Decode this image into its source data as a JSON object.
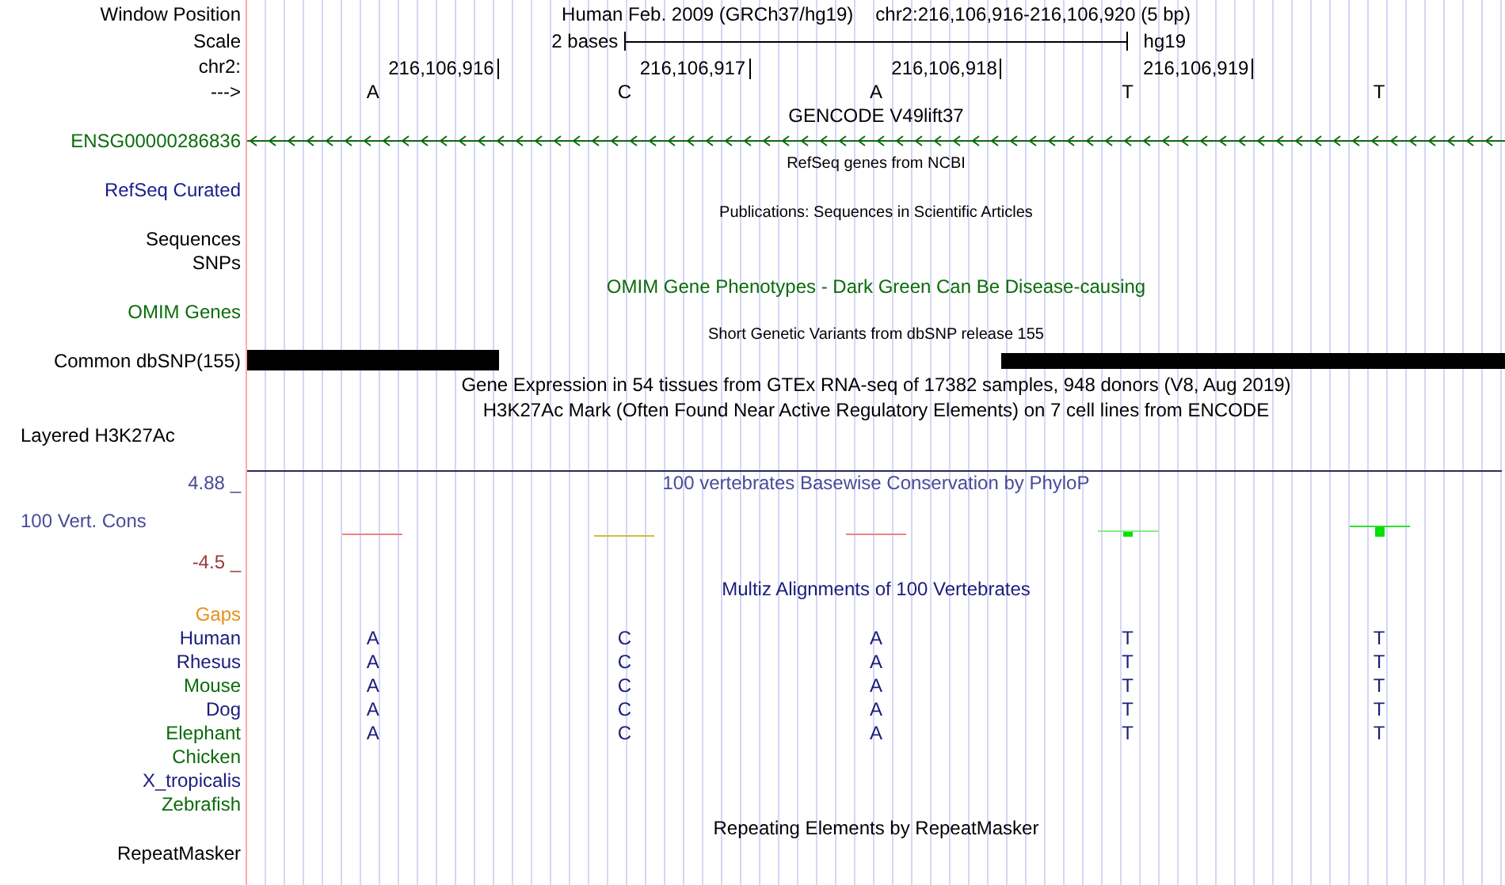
{
  "rows": [
    {
      "kind": "title",
      "label": "Window Position",
      "assembly": "Human Feb. 2009 (GRCh37/hg19)",
      "position": "chr2:216,106,916-216,106,920 (5 bp)"
    },
    {
      "kind": "scale",
      "label": "Scale",
      "scale_text": "2 bases",
      "scale_assembly": "hg19"
    },
    {
      "kind": "ruler",
      "label": "chr2:",
      "ticks": [
        "216,106,916",
        "216,106,917",
        "216,106,918",
        "216,106,919"
      ]
    },
    {
      "kind": "bases",
      "label": "--->",
      "bases": [
        "A",
        "C",
        "A",
        "T",
        "T"
      ]
    },
    {
      "kind": "caption",
      "text": "GENCODE V49lift37",
      "color": "#000000"
    },
    {
      "kind": "gene",
      "label": "ENSG00000286836",
      "color": "#0b6b0b"
    },
    {
      "kind": "note",
      "text": "RefSeq genes from NCBI"
    },
    {
      "kind": "track",
      "label": "RefSeq Curated",
      "color": "#1c1c8c"
    },
    {
      "kind": "note",
      "text": "Publications: Sequences in Scientific Articles"
    },
    {
      "kind": "track",
      "label": "Sequences",
      "color": "#000000"
    },
    {
      "kind": "track",
      "label": "SNPs",
      "color": "#000000"
    },
    {
      "kind": "caption",
      "text": "OMIM Gene Phenotypes - Dark Green Can Be Disease-causing",
      "color": "#0b6b0b"
    },
    {
      "kind": "track",
      "label": "OMIM Genes",
      "color": "#0b6b0b"
    },
    {
      "kind": "note",
      "text": "Short Genetic Variants from dbSNP release 155"
    },
    {
      "kind": "snp_bars",
      "label": "Common dbSNP(155)",
      "color": "#000000"
    },
    {
      "kind": "caption",
      "text": "Gene Expression in 54 tissues from GTEx RNA-seq of 17382 samples, 948 donors (V8, Aug 2019)",
      "color": "#000000"
    },
    {
      "kind": "caption",
      "text": "H3K27Ac Mark (Often Found Near Active Regulatory Elements) on 7 cell lines from ENCODE",
      "color": "#000000"
    },
    {
      "kind": "left_label",
      "label": "Layered H3K27Ac",
      "color": "#000000"
    },
    {
      "kind": "rule"
    },
    {
      "kind": "axis_top",
      "label": "4.88 _",
      "text": "100 vertebrates Basewise Conservation by PhyloP",
      "color": "#4a4a9a"
    },
    {
      "kind": "wiggle",
      "label": "100 Vert. Cons",
      "color": "#4a4a9a"
    },
    {
      "kind": "axis_bottom",
      "label": "-4.5 _",
      "color": "#9a3a3a"
    },
    {
      "kind": "caption",
      "text": "Multiz Alignments of 100 Vertebrates",
      "color": "#1c1c7c"
    },
    {
      "kind": "track",
      "label": "Gaps",
      "color": "#e8901c"
    },
    {
      "kind": "species",
      "label": "Human",
      "color": "#1c1c7c",
      "bases": [
        "A",
        "C",
        "A",
        "T",
        "T"
      ]
    },
    {
      "kind": "species",
      "label": "Rhesus",
      "color": "#1c1c7c",
      "bases": [
        "A",
        "C",
        "A",
        "T",
        "T"
      ]
    },
    {
      "kind": "species",
      "label": "Mouse",
      "color": "#0b6b0b",
      "bases": [
        "A",
        "C",
        "A",
        "T",
        "T"
      ]
    },
    {
      "kind": "species",
      "label": "Dog",
      "color": "#1c1c7c",
      "bases": [
        "A",
        "C",
        "A",
        "T",
        "T"
      ]
    },
    {
      "kind": "species",
      "label": "Elephant",
      "color": "#0b6b0b",
      "bases": [
        "A",
        "C",
        "A",
        "T",
        "T"
      ]
    },
    {
      "kind": "species",
      "label": "Chicken",
      "color": "#0b6b0b",
      "bases": []
    },
    {
      "kind": "species",
      "label": "X_tropicalis",
      "color": "#1c1c7c",
      "bases": []
    },
    {
      "kind": "species",
      "label": "Zebrafish",
      "color": "#0b6b0b",
      "bases": []
    },
    {
      "kind": "caption",
      "text": "Repeating Elements by RepeatMasker",
      "color": "#000000"
    },
    {
      "kind": "track",
      "label": "RepeatMasker",
      "color": "#000000"
    }
  ]
}
